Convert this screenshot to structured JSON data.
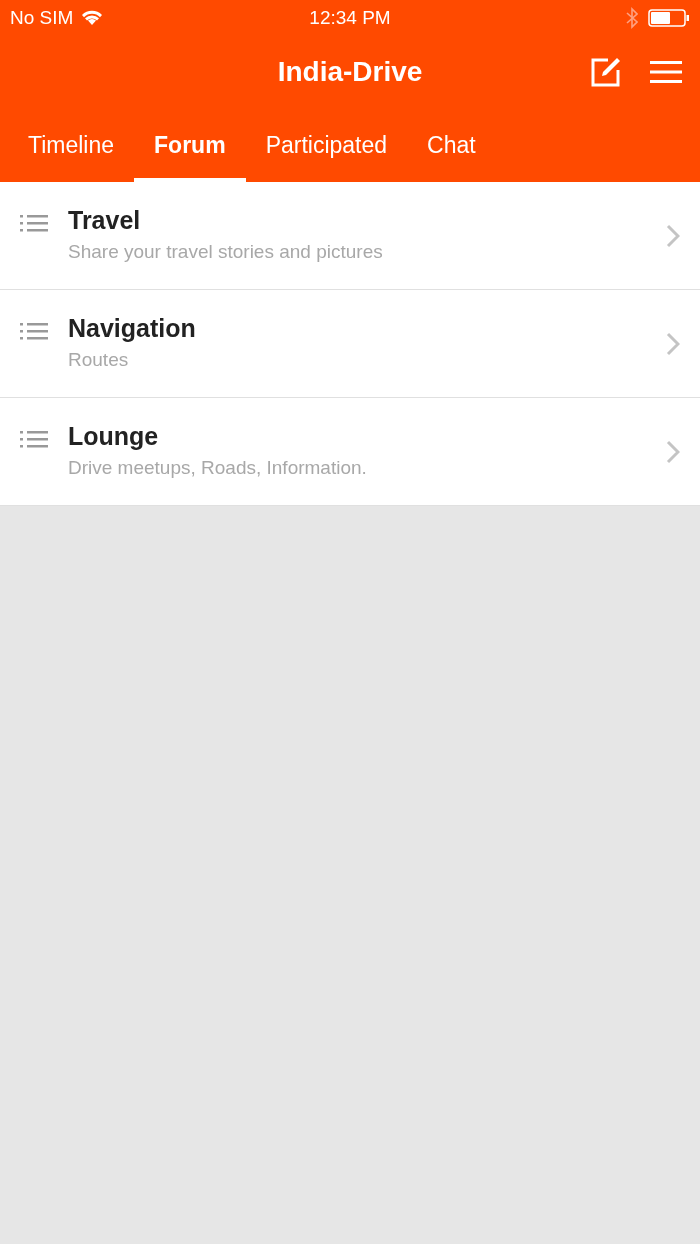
{
  "status_bar": {
    "carrier": "No SIM",
    "time": "12:34 PM"
  },
  "header": {
    "title": "India-Drive"
  },
  "tabs": [
    {
      "label": "Timeline",
      "selected": false
    },
    {
      "label": "Forum",
      "selected": true
    },
    {
      "label": "Participated",
      "selected": false
    },
    {
      "label": "Chat",
      "selected": false
    }
  ],
  "forums": [
    {
      "title": "Travel",
      "subtitle": "Share your travel stories and pictures"
    },
    {
      "title": "Navigation",
      "subtitle": "Routes"
    },
    {
      "title": "Lounge",
      "subtitle": "Drive meetups, Roads, Information."
    }
  ]
}
